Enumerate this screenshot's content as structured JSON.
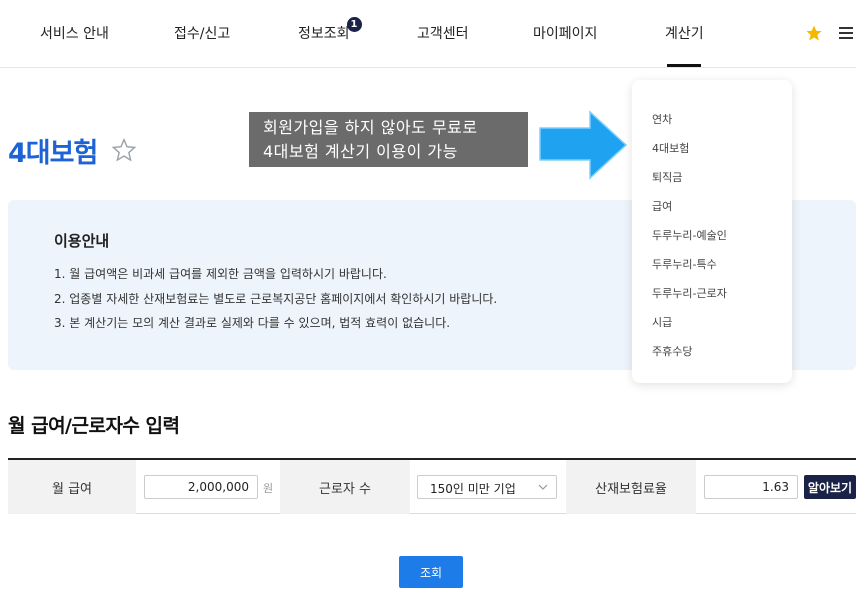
{
  "nav": {
    "items": [
      {
        "label": "서비스 안내"
      },
      {
        "label": "접수/신고"
      },
      {
        "label": "정보조회",
        "badge": "1"
      },
      {
        "label": "고객센터"
      },
      {
        "label": "마이페이지"
      },
      {
        "label": "계산기",
        "active": true
      }
    ]
  },
  "page": {
    "title": "4대보험"
  },
  "callout": {
    "line1": "회원가입을 하지 않아도 무료로",
    "line2": "4대보험 계산기 이용이 가능"
  },
  "info": {
    "title": "이용안내",
    "lines": [
      "1. 월 급여액은 비과세 급여를 제외한 금액을 입력하시기 바랍니다.",
      "2. 업종별 자세한 산재보험료는 별도로 근로복지공단 홈페이지에서 확인하시기 바랍니다.",
      "3. 본 계산기는 모의 계산 결과로 실제와 다를 수 있으며, 법적 효력이 없습니다."
    ]
  },
  "dropdown": {
    "items": [
      "연차",
      "4대보험",
      "퇴직금",
      "급여",
      "두루누리-예술인",
      "두루누리-특수",
      "두루누리-근로자",
      "시급",
      "주휴수당"
    ]
  },
  "form": {
    "section_title": "월 급여/근로자수 입력",
    "salary_label": "월 급여",
    "salary_value": "2,000,000",
    "salary_unit": "원",
    "workers_label": "근로자 수",
    "workers_selected": "150인 미만 기업",
    "rate_label": "산재보험료율",
    "rate_value": "1.63",
    "lookup_label": "알아보기",
    "submit_label": "조회"
  },
  "colors": {
    "brand_blue": "#1e63d6",
    "navy": "#1a2248",
    "button_blue": "#1e7ce8",
    "info_bg": "#eef4fb",
    "arrow_blue": "#1fa3f0",
    "star_gold": "#f5b800"
  }
}
